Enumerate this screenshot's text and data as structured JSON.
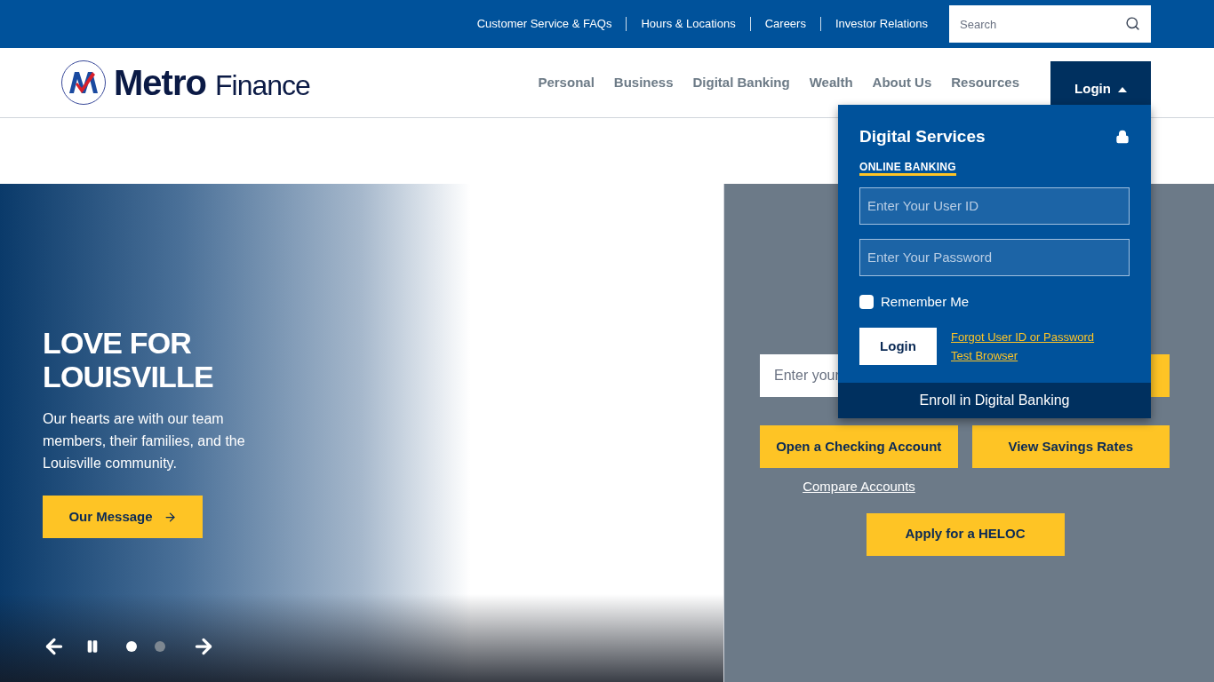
{
  "utility_nav": {
    "links": [
      "Customer Service & FAQs",
      "Hours & Locations",
      "Careers",
      "Investor Relations"
    ],
    "search": {
      "placeholder": "Search"
    }
  },
  "header": {
    "logo": {
      "name_bold": "Metro",
      "name_light": "Finance"
    },
    "nav": [
      "Personal",
      "Business",
      "Digital Banking",
      "Wealth",
      "About Us",
      "Resources"
    ],
    "login_button": {
      "label": "Login",
      "expanded": true
    }
  },
  "login_dropdown": {
    "title": "Digital Services",
    "tab": "ONLINE BANKING",
    "user_id": {
      "placeholder": "Enter Your User ID"
    },
    "password": {
      "placeholder": "Enter Your Password"
    },
    "remember_me": {
      "label": "Remember Me",
      "checked": false
    },
    "submit": "Login",
    "links": [
      "Forgot User ID or Password",
      "Test Browser"
    ],
    "enroll": "Enroll in Digital Banking"
  },
  "hero": {
    "title": "LOVE FOR LOUISVILLE",
    "text": "Our hearts are with our team members, their families, and the Louisville community.",
    "button": "Our Message",
    "carousel": {
      "paused": false,
      "dots": [
        {
          "selected": true
        },
        {
          "selected": false
        }
      ]
    }
  },
  "side_panel": {
    "search_field": {
      "placeholder": "Enter your"
    },
    "buttons": [
      "Open a Checking Account",
      "View Savings Rates"
    ],
    "compare_link": "Compare Accounts",
    "heloc_button": "Apply for a HELOC"
  }
}
